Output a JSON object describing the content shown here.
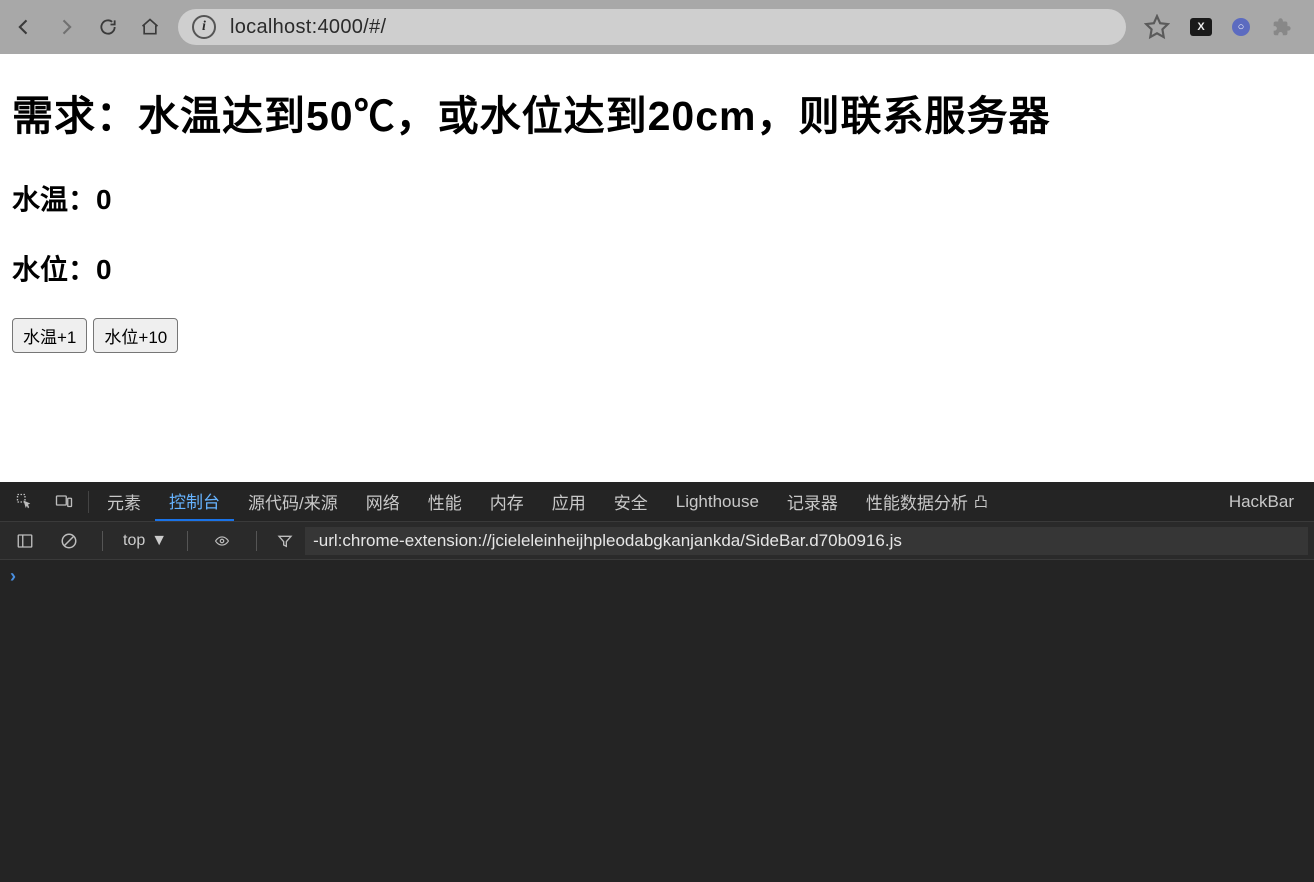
{
  "browser": {
    "url": "localhost:4000/#/"
  },
  "page": {
    "heading": "需求：水温达到50℃，或水位达到20cm，则联系服务器",
    "temp_label": "水温：",
    "temp_value": "0",
    "level_label": "水位：",
    "level_value": "0",
    "btn_temp": "水温+1",
    "btn_level": "水位+10"
  },
  "devtools": {
    "tabs": {
      "elements": "元素",
      "console": "控制台",
      "sources": "源代码/来源",
      "network": "网络",
      "performance": "性能",
      "memory": "内存",
      "application": "应用",
      "security": "安全",
      "lighthouse": "Lighthouse",
      "recorder": "记录器",
      "perf_insights": "性能数据分析",
      "hackbar": "HackBar"
    },
    "context": "top",
    "filter_value": "-url:chrome-extension://jcieleleinheijhpleodabgkanjankda/SideBar.d70b0916.js",
    "prompt": "›"
  }
}
